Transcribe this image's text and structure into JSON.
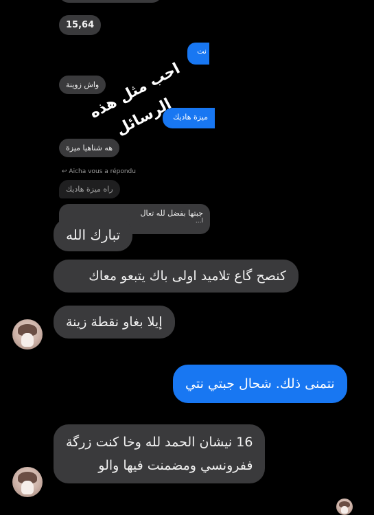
{
  "messages": {
    "top_partial": "15,64",
    "out_partial_1": "نت",
    "m1": "واش زوينة",
    "out_partial_2": "ميزة هاديك",
    "m2": "هه شناهيا ميزة",
    "reply_label": "Aicha vous a répondu",
    "reply_quote": "راه ميزة هاديك",
    "m3_partial": "جبتها بفضل لله تعال",
    "m3_partial_2": "ا...",
    "m4": "تبارك الله",
    "m5": "كنصح گاع تلاميد اولى باك يتبعو معاك",
    "m6": "إيلا بغاو نقطة زينة",
    "out_1": "نتمنى ذلك. شحال جبتي نتي",
    "m7_line1": "16 نيشان الحمد لله وخا كنت زرگة",
    "m7_line2": "ففرونسي ومضمنت فيها والو"
  },
  "overlay": {
    "line1": "احب مثل هذه",
    "line2": "الرسائل"
  },
  "icons": {
    "reply": "reply-arrow-icon",
    "avatar": "profile-avatar"
  }
}
